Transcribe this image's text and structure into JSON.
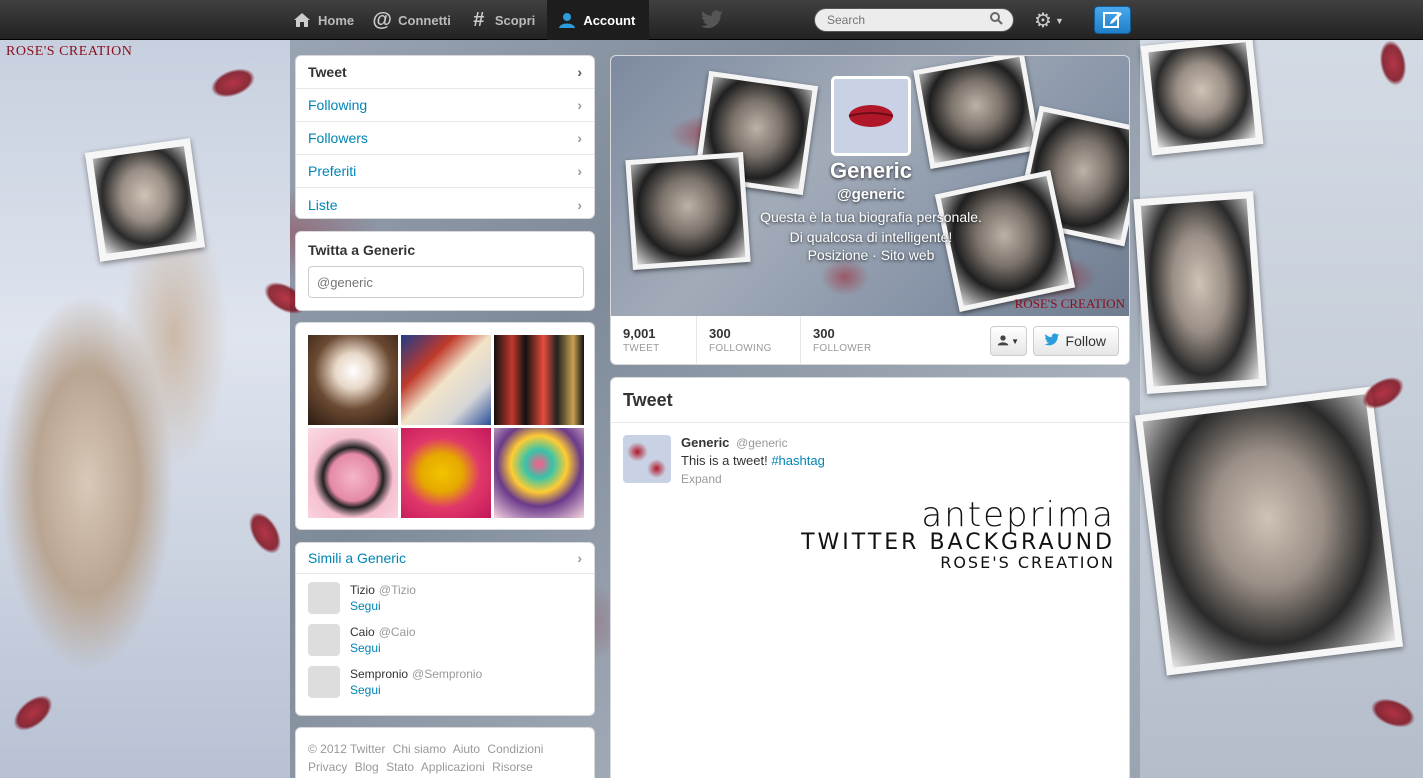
{
  "background": {
    "watermark": "ROSE'S CREATION"
  },
  "topbar": {
    "nav": [
      {
        "label": "Home",
        "icon": "home-icon"
      },
      {
        "label": "Connetti",
        "icon": "at-icon"
      },
      {
        "label": "Scopri",
        "icon": "hash-icon"
      },
      {
        "label": "Account",
        "icon": "user-icon"
      }
    ],
    "active_nav": "Account",
    "search_placeholder": "Search"
  },
  "sidebar": {
    "dashboard": [
      "Tweet",
      "Following",
      "Followers",
      "Preferiti",
      "Liste"
    ],
    "tweet_to": {
      "title": "Twitta a Generic",
      "placeholder": "@generic"
    },
    "similar": {
      "title": "Simili a Generic",
      "follow_label": "Segui",
      "users": [
        {
          "name": "Tizio",
          "handle": "@Tizio"
        },
        {
          "name": "Caio",
          "handle": "@Caio"
        },
        {
          "name": "Sempronio",
          "handle": "@Sempronio"
        }
      ]
    },
    "footer": {
      "line1": [
        "© 2012 Twitter",
        "Chi siamo",
        "Aiuto",
        "Condizioni"
      ],
      "line2": [
        "Privacy",
        "Blog",
        "Stato",
        "Applicazioni",
        "Risorse"
      ]
    }
  },
  "profile": {
    "name": "Generic",
    "handle": "@generic",
    "bio_line1": "Questa è la tua biografia personale.",
    "bio_line2": "Di qualcosa di intelligente!",
    "location_line": "Posizione · Sito web",
    "banner_watermark": "ROSE'S CREATION",
    "stats": [
      {
        "value": "9,001",
        "label": "TWEET"
      },
      {
        "value": "300",
        "label": "FOLLOWING"
      },
      {
        "value": "300",
        "label": "FOLLOWER"
      }
    ],
    "follow_label": "Follow"
  },
  "timeline": {
    "title": "Tweet",
    "tweet": {
      "name": "Generic",
      "handle": "@generic",
      "text": "This is a tweet!",
      "hashtag": "#hashtag",
      "expand": "Expand"
    },
    "preview_art": {
      "line1": "anteprima",
      "line2": "TWITTER BACKGRAUND",
      "line3": "ROSE'S CREATION"
    }
  },
  "colors": {
    "link": "#0084b4",
    "topbar": "#2a2a2a",
    "compose": "#2b8ee0",
    "kiss": "#b0182a"
  }
}
